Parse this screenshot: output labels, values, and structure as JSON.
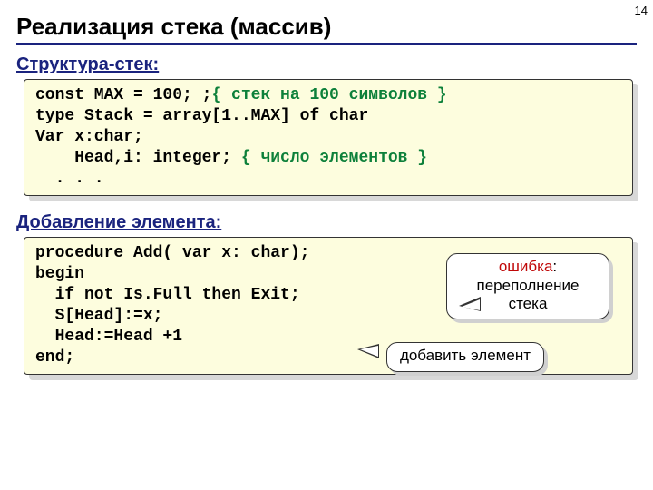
{
  "pageNumber": "14",
  "title": "Реализация стека (массив)",
  "section1": "Структура-стек:",
  "code1": {
    "l1a": "const MAX = 100; ;",
    "l1b": "{ стек на 100 символов }",
    "l2": "type Stack = array[1..MAX] of char",
    "l3": "Var x:char;",
    "l4a": "    Head,i: integer; ",
    "l4b": "{ число элементов }",
    "l5": "  . . ."
  },
  "section2": "Добавление элемента:",
  "code2": {
    "l1": "procedure Add( var x: char);",
    "l2": "begin",
    "l3": "  if not Is.Full then Exit;",
    "l4": "  S[Head]:=x;",
    "l5": "  Head:=Head +1",
    "l6": "end;"
  },
  "callout1": {
    "err": "ошибка",
    "rest": ":\nпереполнение стека"
  },
  "callout2": "добавить элемент"
}
